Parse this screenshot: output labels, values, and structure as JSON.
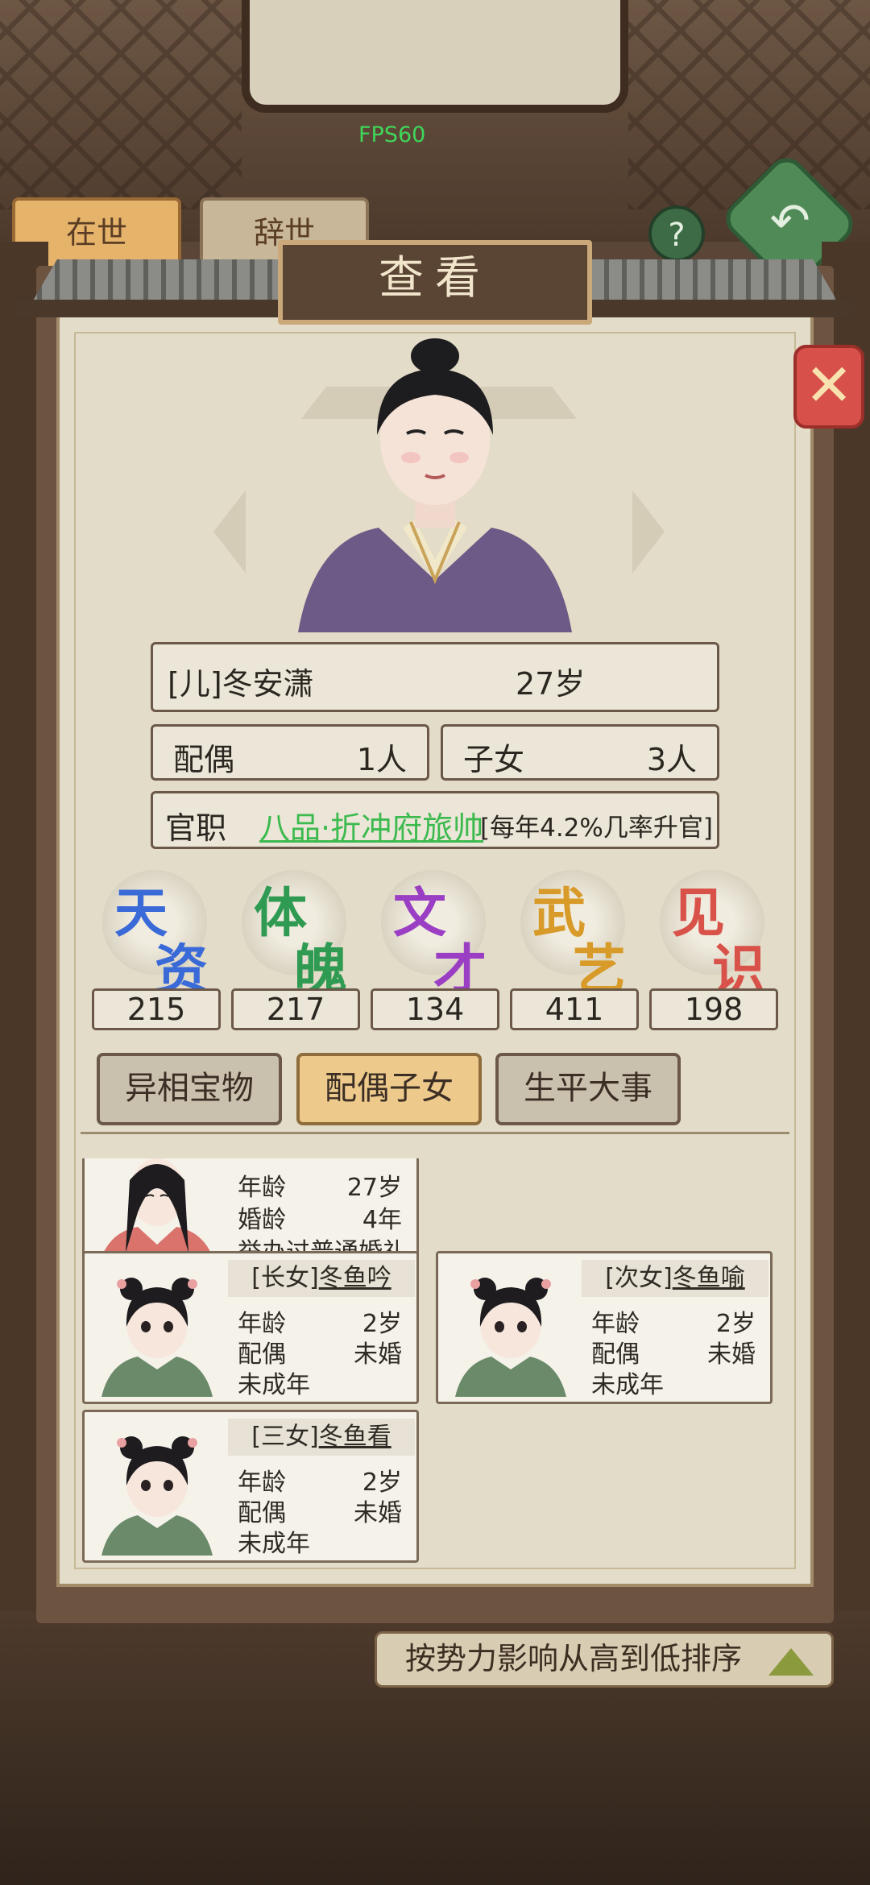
{
  "hud": {
    "fps": "FPS60"
  },
  "background": {
    "tab_alive": "在世",
    "tab_deceased": "辞世",
    "help_icon": "?",
    "sort_text": "按势力影响从高到低排序"
  },
  "modal": {
    "title": "查看",
    "close_icon": "close-icon",
    "person": {
      "name": "[儿]冬安潇",
      "age": "27岁",
      "spouse_label": "配偶",
      "spouse_value": "1人",
      "children_label": "子女",
      "children_value": "3人",
      "office_label": "官职",
      "office_rank": "八品·折冲府旅帅",
      "office_chance": "[每年4.2%几率升官]"
    },
    "attributes": [
      {
        "c1": "天",
        "c2": "资",
        "value": "215",
        "color": "#3a6ad8"
      },
      {
        "c1": "体",
        "c2": "魄",
        "value": "217",
        "color": "#2f9a52"
      },
      {
        "c1": "文",
        "c2": "才",
        "value": "134",
        "color": "#9a3ec4"
      },
      {
        "c1": "武",
        "c2": "艺",
        "value": "411",
        "color": "#d89a28"
      },
      {
        "c1": "见",
        "c2": "识",
        "value": "198",
        "color": "#d8524a"
      }
    ],
    "tabs": [
      "异相宝物",
      "配偶子女",
      "生平大事"
    ],
    "spouse_card": {
      "row1_label": "年龄",
      "row1_value": "27岁",
      "row2_label": "婚龄",
      "row2_value": "4年",
      "row3": "举办过普通婚礼"
    },
    "children": [
      {
        "prefix": "[长女]",
        "name": "冬鱼吟",
        "age_label": "年龄",
        "age": "2岁",
        "spouse_label": "配偶",
        "spouse": "未婚",
        "status": "未成年"
      },
      {
        "prefix": "[次女]",
        "name": "冬鱼喻",
        "age_label": "年龄",
        "age": "2岁",
        "spouse_label": "配偶",
        "spouse": "未婚",
        "status": "未成年"
      },
      {
        "prefix": "[三女]",
        "name": "冬鱼看",
        "age_label": "年龄",
        "age": "2岁",
        "spouse_label": "配偶",
        "spouse": "未婚",
        "status": "未成年"
      }
    ]
  }
}
